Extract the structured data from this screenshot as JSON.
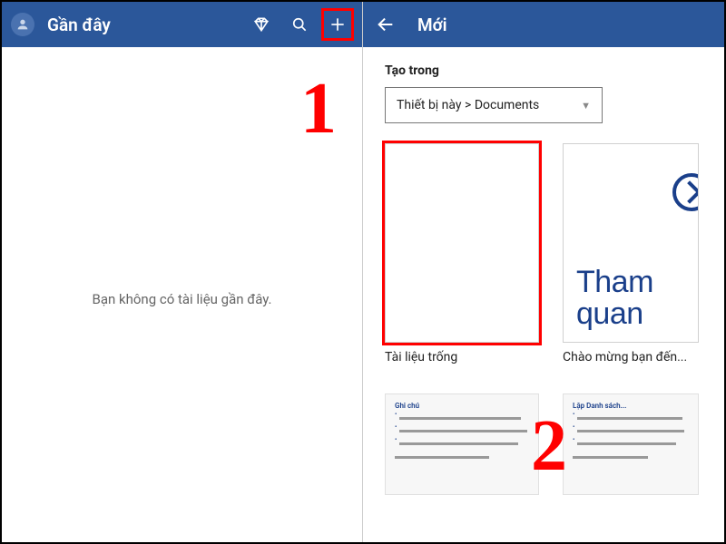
{
  "left": {
    "title": "Gần đây",
    "empty": "Bạn không có tài liệu gần đây."
  },
  "right": {
    "title": "Mới",
    "section_label": "Tạo trong",
    "location": "Thiết bị này > Documents",
    "templates": [
      {
        "label": "Tài liệu trống"
      },
      {
        "label": "Chào mừng bạn đến...",
        "tour_title": "Tham quan"
      }
    ],
    "mini": {
      "t1": "Ghi chú",
      "t2": "Lập Danh sách..."
    }
  },
  "steps": {
    "one": "1",
    "two": "2"
  }
}
